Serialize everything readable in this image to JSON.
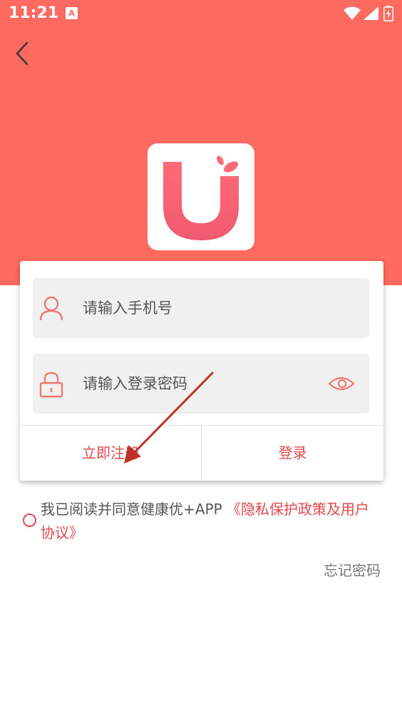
{
  "status_bar": {
    "time": "11:21",
    "notification_badge": "A"
  },
  "colors": {
    "brand": "#ff6a60",
    "accent_text": "#e5484d",
    "logo_gradient_start": "#ff6a78",
    "logo_gradient_end": "#f05a70"
  },
  "icons": [
    "back-arrow-icon",
    "wifi-icon",
    "signal-icon",
    "battery-icon",
    "user-icon",
    "lock-icon",
    "eye-icon"
  ],
  "login": {
    "phone_placeholder": "请输入手机号",
    "password_placeholder": "请输入登录密码",
    "register_label": "立即注册",
    "login_label": "登录"
  },
  "agreement": {
    "prefix": "我已阅读并同意健康优+APP ",
    "link": "《隐私保护政策及用户协议》"
  },
  "forgot_password": "忘记密码"
}
